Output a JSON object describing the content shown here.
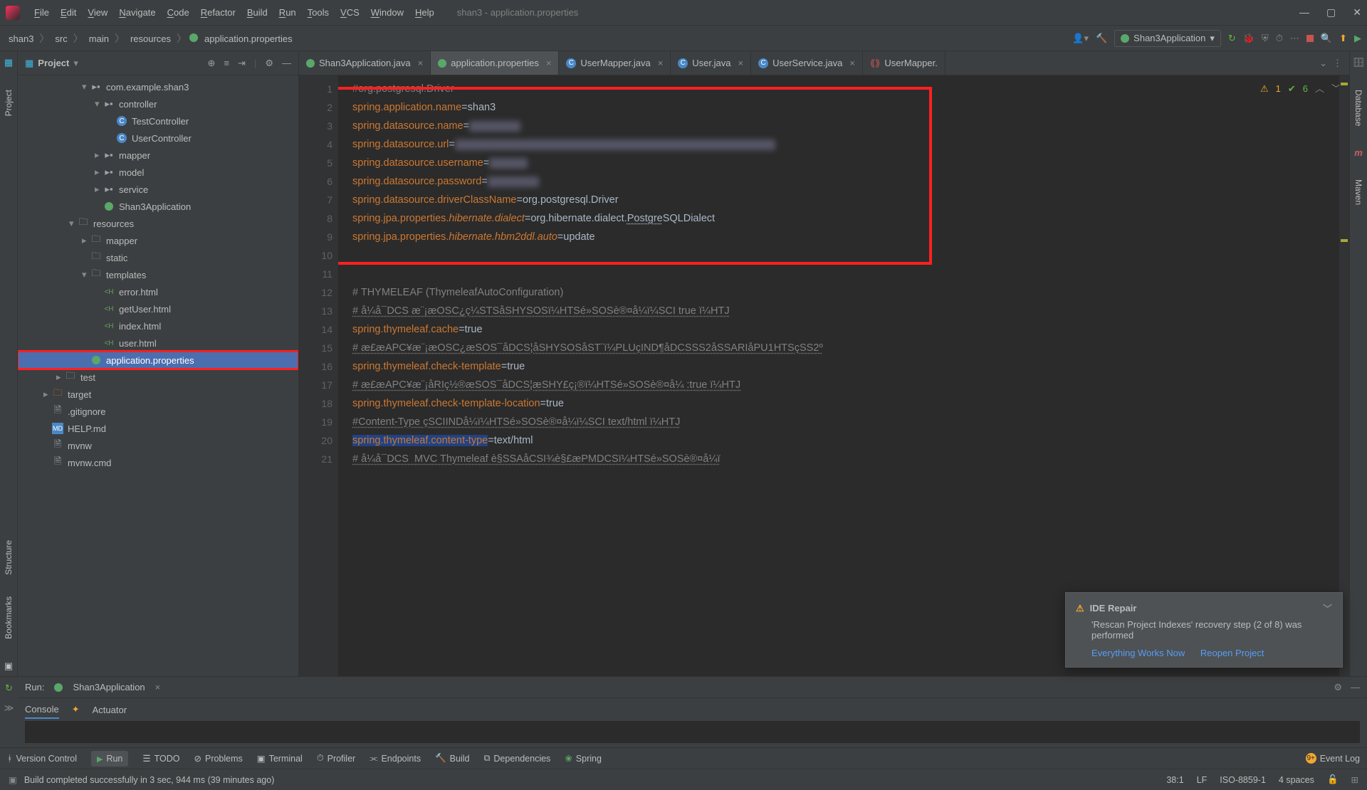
{
  "menu": [
    "File",
    "Edit",
    "View",
    "Navigate",
    "Code",
    "Refactor",
    "Build",
    "Run",
    "Tools",
    "VCS",
    "Window",
    "Help"
  ],
  "window_title": "shan3 - application.properties",
  "breadcrumbs": [
    "shan3",
    "src",
    "main",
    "resources",
    "application.properties"
  ],
  "run_config_label": "Shan3Application",
  "project_panel_title": "Project",
  "left_tools": [
    "Project"
  ],
  "left_tools2": [
    "Structure",
    "Bookmarks"
  ],
  "right_tools": [
    "Database",
    "Maven"
  ],
  "tree": [
    {
      "indent": 5,
      "arrow": "▾",
      "icon": "pkg",
      "label": "com.example.shan3"
    },
    {
      "indent": 6,
      "arrow": "▾",
      "icon": "pkg",
      "label": "controller"
    },
    {
      "indent": 7,
      "arrow": "",
      "icon": "class",
      "label": "TestController"
    },
    {
      "indent": 7,
      "arrow": "",
      "icon": "class",
      "label": "UserController"
    },
    {
      "indent": 6,
      "arrow": "▸",
      "icon": "pkg",
      "label": "mapper"
    },
    {
      "indent": 6,
      "arrow": "▸",
      "icon": "pkg",
      "label": "model"
    },
    {
      "indent": 6,
      "arrow": "▸",
      "icon": "pkg",
      "label": "service"
    },
    {
      "indent": 6,
      "arrow": "",
      "icon": "spring",
      "label": "Shan3Application"
    },
    {
      "indent": 4,
      "arrow": "▾",
      "icon": "res",
      "label": "resources"
    },
    {
      "indent": 5,
      "arrow": "▸",
      "icon": "folder",
      "label": "mapper"
    },
    {
      "indent": 5,
      "arrow": "",
      "icon": "folder",
      "label": "static"
    },
    {
      "indent": 5,
      "arrow": "▾",
      "icon": "folder",
      "label": "templates"
    },
    {
      "indent": 6,
      "arrow": "",
      "icon": "html",
      "label": "error.html"
    },
    {
      "indent": 6,
      "arrow": "",
      "icon": "html",
      "label": "getUser.html"
    },
    {
      "indent": 6,
      "arrow": "",
      "icon": "html",
      "label": "index.html"
    },
    {
      "indent": 6,
      "arrow": "",
      "icon": "html",
      "label": "user.html"
    },
    {
      "indent": 5,
      "arrow": "",
      "icon": "spring",
      "label": "application.properties",
      "sel": true,
      "hl": true
    },
    {
      "indent": 3,
      "arrow": "▸",
      "icon": "folder",
      "label": "test"
    },
    {
      "indent": 2,
      "arrow": "▸",
      "icon": "target",
      "label": "target"
    },
    {
      "indent": 2,
      "arrow": "",
      "icon": "file",
      "label": ".gitignore"
    },
    {
      "indent": 2,
      "arrow": "",
      "icon": "md",
      "label": "HELP.md"
    },
    {
      "indent": 2,
      "arrow": "",
      "icon": "file",
      "label": "mvnw"
    },
    {
      "indent": 2,
      "arrow": "",
      "icon": "file",
      "label": "mvnw.cmd"
    }
  ],
  "tabs": [
    {
      "icon": "spring",
      "label": "Shan3Application.java",
      "close": true
    },
    {
      "icon": "spring",
      "label": "application.properties",
      "close": true,
      "active": true
    },
    {
      "icon": "class",
      "label": "UserMapper.java",
      "close": true
    },
    {
      "icon": "class",
      "label": "User.java",
      "close": true
    },
    {
      "icon": "class",
      "label": "UserService.java",
      "close": true
    },
    {
      "icon": "xml",
      "label": "UserMapper.",
      "close": false
    }
  ],
  "hints": {
    "warn": "1",
    "ok": "6"
  },
  "code": [
    {
      "n": 1,
      "segs": [
        {
          "t": "#org.postgresql.Driver",
          "c": "cmt"
        }
      ]
    },
    {
      "n": 2,
      "segs": [
        {
          "t": "spring.application.name",
          "c": "key"
        },
        {
          "t": "=",
          "c": "val"
        },
        {
          "t": "shan3",
          "c": "val",
          "blur": false
        }
      ]
    },
    {
      "n": 3,
      "segs": [
        {
          "t": "spring.datasource.name",
          "c": "key"
        },
        {
          "t": "=",
          "c": "val"
        },
        {
          "t": "        ",
          "c": "val",
          "blur": true
        }
      ]
    },
    {
      "n": 4,
      "segs": [
        {
          "t": "spring.datasource.url",
          "c": "key"
        },
        {
          "t": "=",
          "c": "val"
        },
        {
          "t": "                                                  ",
          "c": "val",
          "blur": true
        }
      ]
    },
    {
      "n": 5,
      "segs": [
        {
          "t": "spring.datasource.username",
          "c": "key"
        },
        {
          "t": "=",
          "c": "val"
        },
        {
          "t": "      ",
          "c": "val",
          "blur": true
        }
      ]
    },
    {
      "n": 6,
      "segs": [
        {
          "t": "spring.datasource.password",
          "c": "key"
        },
        {
          "t": "=",
          "c": "val"
        },
        {
          "t": "        ",
          "c": "val",
          "blur": true
        }
      ]
    },
    {
      "n": 7,
      "segs": [
        {
          "t": "spring.datasource.driverClassName",
          "c": "key"
        },
        {
          "t": "=",
          "c": "val"
        },
        {
          "t": "org.postgresql.Driver",
          "c": "val"
        }
      ]
    },
    {
      "n": 8,
      "segs": [
        {
          "t": "spring.jpa.properties.",
          "c": "key"
        },
        {
          "t": "hibernate.dialect",
          "c": "it"
        },
        {
          "t": "=",
          "c": "val"
        },
        {
          "t": "org.hibernate.dialect.",
          "c": "val"
        },
        {
          "t": "Postgre",
          "c": "val",
          "u": true
        },
        {
          "t": "SQLDialect",
          "c": "val"
        }
      ]
    },
    {
      "n": 9,
      "segs": [
        {
          "t": "spring.jpa.properties.",
          "c": "key"
        },
        {
          "t": "hibernate.hbm2ddl.auto",
          "c": "it"
        },
        {
          "t": "=",
          "c": "val"
        },
        {
          "t": "update",
          "c": "val"
        }
      ]
    },
    {
      "n": 10,
      "segs": []
    },
    {
      "n": 11,
      "segs": []
    },
    {
      "n": 12,
      "segs": [
        {
          "t": "# THYMELEAF (ThymeleafAutoConfiguration)",
          "c": "cmt"
        }
      ]
    },
    {
      "n": 13,
      "segs": [
        {
          "t": "# å¼å¯DCS æ¨¡æOSC¿ç¼STSåSHYSOSï¼HTSé»SOSè®¤å¼ï¼SCI true ï¼HTJ",
          "c": "cmt",
          "u": true
        }
      ]
    },
    {
      "n": 14,
      "segs": [
        {
          "t": "spring.thymeleaf.cache",
          "c": "key"
        },
        {
          "t": "=",
          "c": "val"
        },
        {
          "t": "true",
          "c": "val"
        }
      ]
    },
    {
      "n": 15,
      "segs": [
        {
          "t": "# æ£æAPC¥æ¨¡æOSC¿æSOS¯åDCS¦åSHYSOSåST¨ï¼PLUçIND¶åDCSSS2åSSARIåPU1HTSçSS2º",
          "c": "cmt",
          "u": true
        }
      ]
    },
    {
      "n": 16,
      "segs": [
        {
          "t": "spring.thymeleaf.check-template",
          "c": "key"
        },
        {
          "t": "=",
          "c": "val"
        },
        {
          "t": "true",
          "c": "val"
        }
      ]
    },
    {
      "n": 17,
      "segs": [
        {
          "t": "# æ£æAPC¥æ¨¡åRIç½®æSOS¯åDCS¦æSHY£ç¡®ï¼HTSé»SOSè®¤å¼ :true ï¼HTJ",
          "c": "cmt",
          "u": true
        }
      ]
    },
    {
      "n": 18,
      "segs": [
        {
          "t": "spring.thymeleaf.check-template-location",
          "c": "key"
        },
        {
          "t": "=",
          "c": "val"
        },
        {
          "t": "true",
          "c": "val"
        }
      ]
    },
    {
      "n": 19,
      "segs": [
        {
          "t": "#Content-Type çSCIINDå¼ï¼HTSé»SOSè®¤å¼ï¼SCI text/html ï¼HTJ",
          "c": "cmt",
          "u": true
        }
      ]
    },
    {
      "n": 20,
      "segs": [
        {
          "t": "spring.thymeleaf.content-type",
          "c": "key",
          "hl": true
        },
        {
          "t": "=",
          "c": "val"
        },
        {
          "t": "text/html",
          "c": "val"
        }
      ]
    },
    {
      "n": 21,
      "segs": [
        {
          "t": "# å¼å¯DCS  MVC Thymeleaf è§SSAåCSI¾è§£æPMDCSï¼HTSé»SOSè®¤å¼ï",
          "c": "cmt",
          "u": true
        }
      ]
    }
  ],
  "run": {
    "label": "Run:",
    "config": "Shan3Application",
    "tabs": [
      "Console",
      "Actuator"
    ]
  },
  "bottom_tools": [
    "Version Control",
    "Run",
    "TODO",
    "Problems",
    "Terminal",
    "Profiler",
    "Endpoints",
    "Build",
    "Dependencies",
    "Spring"
  ],
  "event_log": "Event Log",
  "status_msg": "Build completed successfully in 3 sec, 944 ms (39 minutes ago)",
  "status_right": {
    "pos": "38:1",
    "le": "LF",
    "enc": "ISO-8859-1",
    "indent": "4 spaces"
  },
  "notif": {
    "title": "IDE Repair",
    "body": "'Rescan Project Indexes' recovery step (2 of 8) was performed",
    "link1": "Everything Works Now",
    "link2": "Reopen Project"
  }
}
